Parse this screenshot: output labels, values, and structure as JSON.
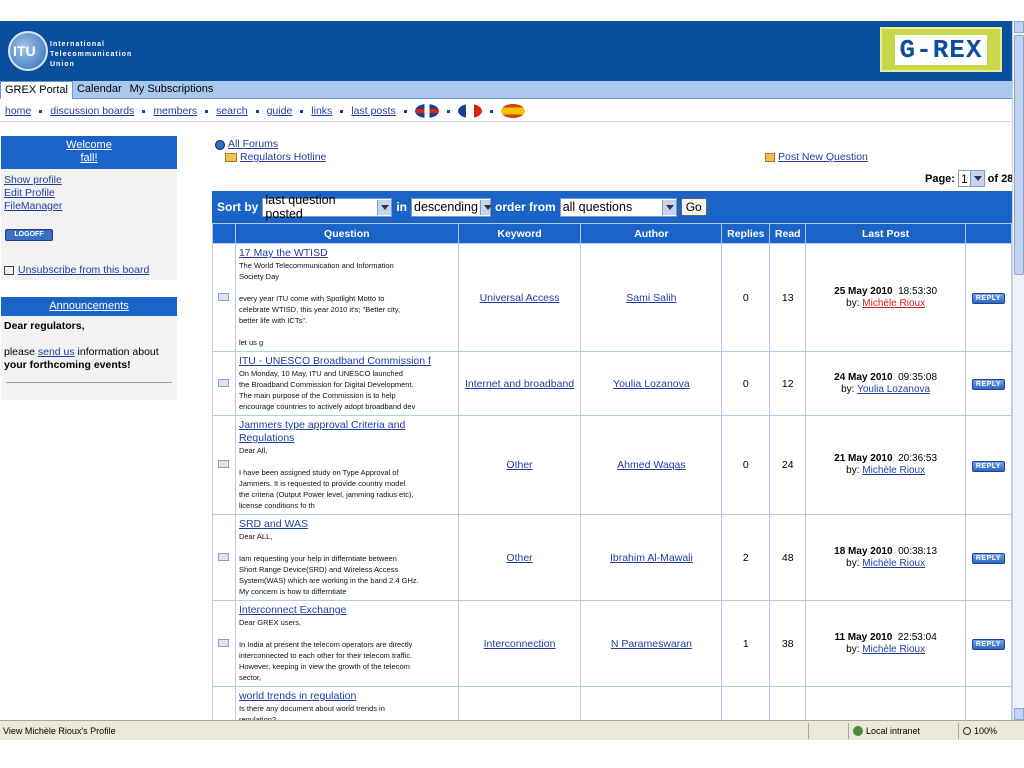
{
  "header": {
    "itu_logo_text": "ITU",
    "itu_name_line1": "International",
    "itu_name_line2": "Telecommunication",
    "itu_name_line3": "Union",
    "grex_logo_text": "G-REX"
  },
  "tabs": [
    {
      "label": "GREX Portal"
    },
    {
      "label": "Calendar"
    },
    {
      "label": "My Subscriptions"
    }
  ],
  "nav": [
    "home",
    "discussion boards",
    "members",
    "search",
    "guide",
    "links",
    "last posts"
  ],
  "sidebar": {
    "welcome_line1": "Welcome",
    "welcome_line2": "fall!",
    "links": [
      "Show profile",
      "Edit Profile",
      "FileManager"
    ],
    "logoff": "LOGOFF",
    "unsubscribe": "Unsubscribe from this board",
    "announcements_title": "Announcements",
    "announce_greeting": "Dear regulators,",
    "announce_pre": "please ",
    "announce_link": "send us",
    "announce_mid": " information about ",
    "announce_bold": "your forthcoming events!"
  },
  "crumbs": {
    "all_forums": "All Forums",
    "board": "Regulators Hotline",
    "post_new": "Post New Question"
  },
  "pager": {
    "label": "Page:",
    "value": "1",
    "of": "of 28"
  },
  "sortbar": {
    "sort_by": "Sort by",
    "sort_value": "last question posted",
    "in": "in",
    "order_value": "descending",
    "order_from": "order from",
    "filter_value": "all questions",
    "go": "Go"
  },
  "table": {
    "headers": [
      "Question",
      "Keyword",
      "Author",
      "Replies",
      "Read",
      "Last Post"
    ],
    "rows": [
      {
        "title": "17 May the WTISD",
        "excerpt": "The World Telecommunication and Information\nSociety Day\n\nevery year ITU come with Spotlight Motto to\ncelebrate WTISD, this year 2010 it's; \"Better city,\nbetter life with ICTs\".\n\nlet us g",
        "keyword": "Universal Access",
        "author": "Sami Salih",
        "replies": "0",
        "read": "13",
        "date": "25 May 2010",
        "time": "18:53:30",
        "by": "by:",
        "by_name": "Michèle Rioux",
        "reply": "REPLY"
      },
      {
        "title": "ITU - UNESCO Broadband Commission f",
        "excerpt": "On Monday, 10 May, ITU and UNESCO launched\nthe Broadband Commission for Digital Development.\nThe main purpose of the Commission is to help\nencourage countries to actively adopt broadband dev",
        "keyword": "Internet and broadband",
        "author": "Youlia Lozanova",
        "replies": "0",
        "read": "12",
        "date": "24 May 2010",
        "time": "09:35:08",
        "by": "by:",
        "by_name": "Youlia Lozanova",
        "reply": "REPLY"
      },
      {
        "title": "Jammers type approval Criteria and\nRegulations",
        "excerpt": "Dear All,\n\nI have been assigned study on Type Approval of\nJammers. It is requested to provide country model\nthe criteria (Output Power level, jamming radius etc),\nlicense conditions fo th",
        "keyword": "Other",
        "author": "Ahmed Waqas",
        "replies": "0",
        "read": "24",
        "date": "21 May 2010",
        "time": "20:36:53",
        "by": "by:",
        "by_name": "Michèle Rioux",
        "reply": "REPLY"
      },
      {
        "title": "SRD and WAS",
        "excerpt": "Dear ALL,\n\nIam requesting your help in differntiate between\nShort Range Device(SRD) and Wireless Access\nSystem(WAS) which are working in the band 2.4 GHz.\nMy concern is how to differntiate",
        "keyword": "Other",
        "author": "Ibrahim Al-Mawali",
        "replies": "2",
        "read": "48",
        "date": "18 May 2010",
        "time": "00:38:13",
        "by": "by:",
        "by_name": "Michèle Rioux",
        "reply": "REPLY"
      },
      {
        "title": "Interconnect Exchange",
        "excerpt": "Dear GREX users,\n\nIn India at present the telecom operators are directly\ninterconnected to each other for their telecom traffic.\nHowever, keeping in view the growth of the telecom\nsector,",
        "keyword": "Interconnection",
        "author": "N Parameswaran",
        "replies": "1",
        "read": "38",
        "date": "11 May 2010",
        "time": "22:53:04",
        "by": "by:",
        "by_name": "Michèle Rioux",
        "reply": "REPLY"
      },
      {
        "title": "world trends in regulation",
        "excerpt": "Is there any document about world trends in\nregulation?",
        "keyword": "",
        "author": "",
        "replies": "",
        "read": "",
        "date": "",
        "time": "",
        "by": "",
        "by_name": "",
        "reply": ""
      }
    ]
  },
  "status": {
    "text": "View Michèle Rioux's Profile",
    "zone": "Local intranet",
    "zoom": "100%"
  }
}
